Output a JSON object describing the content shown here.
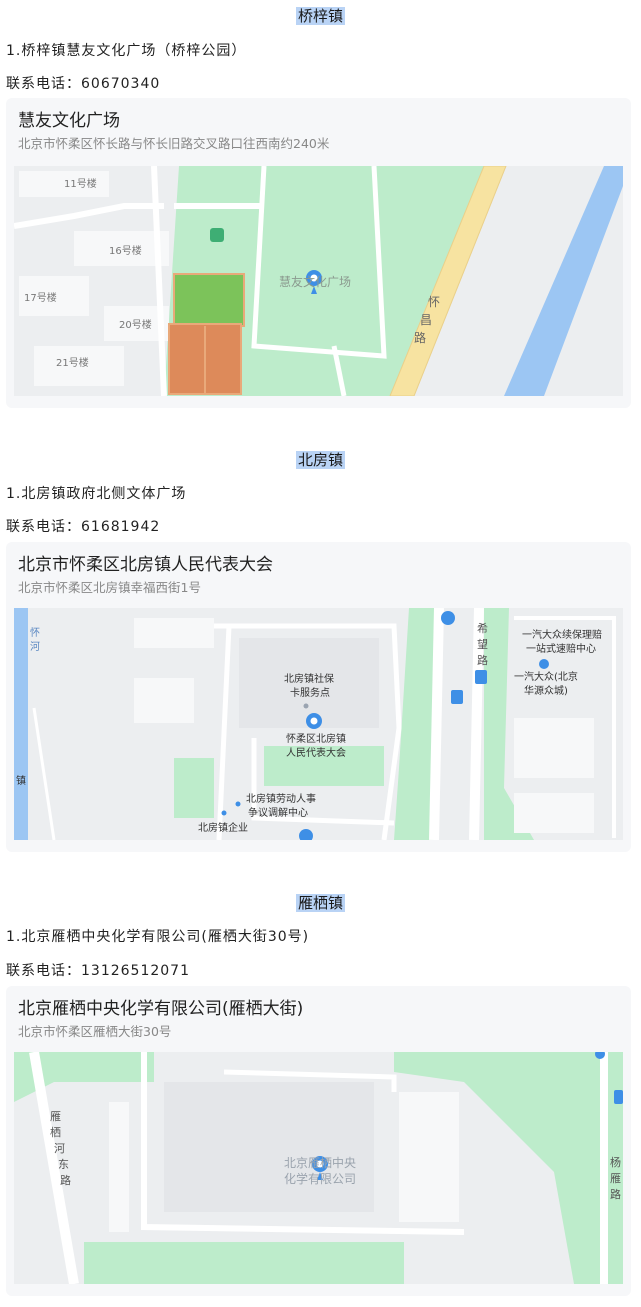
{
  "sections": [
    {
      "town": "桥梓镇",
      "venue": "1.桥梓镇慧友文化广场（桥梓公园）",
      "phone": "联系电话：60670340",
      "card": {
        "title": "慧友文化广场",
        "address": "北京市怀柔区怀长路与怀长旧路交叉路口往西南约240米"
      },
      "map": {
        "labels": [
          "11号楼",
          "16号楼",
          "17号楼",
          "20号楼",
          "21号楼",
          "慧友文化广场",
          "怀",
          "昌",
          "路"
        ]
      }
    },
    {
      "town": "北房镇",
      "venue": "1.北房镇政府北侧文体广场",
      "phone": "联系电话：61681942",
      "card": {
        "title": "北京市怀柔区北房镇人民代表大会",
        "address": "北京市怀柔区北房镇幸福西街1号"
      },
      "map": {
        "labels": [
          "北房镇社保",
          "卡服务点",
          "怀柔区北房镇",
          "人民代表大会",
          "北房镇劳动人事",
          "争议调解中心",
          "北房镇企业",
          "希",
          "望",
          "路",
          "一汽大众续保理赔",
          "一站式速赔中心",
          "一汽大众(北京",
          "华源众城)",
          "怀",
          "河",
          "镇"
        ]
      }
    },
    {
      "town": "雁栖镇",
      "venue": "1.北京雁栖中央化学有限公司(雁栖大街30号)",
      "phone": "联系电话：13126512071",
      "card": {
        "title": "北京雁栖中央化学有限公司(雁栖大街)",
        "address": "北京市怀柔区雁栖大街30号"
      },
      "map": {
        "labels": [
          "雁",
          "栖",
          "河",
          "东",
          "路",
          "北京雁栖中央",
          "化学有限公司",
          "杨",
          "雁",
          "路"
        ]
      }
    }
  ],
  "colors": {
    "highlight": "#b9d3f5",
    "green": "#bdeccb",
    "road": "#ffffff",
    "water": "#9cc6f3",
    "yellow_road": "#f7e3a1",
    "marker": "#3e8fe6"
  }
}
